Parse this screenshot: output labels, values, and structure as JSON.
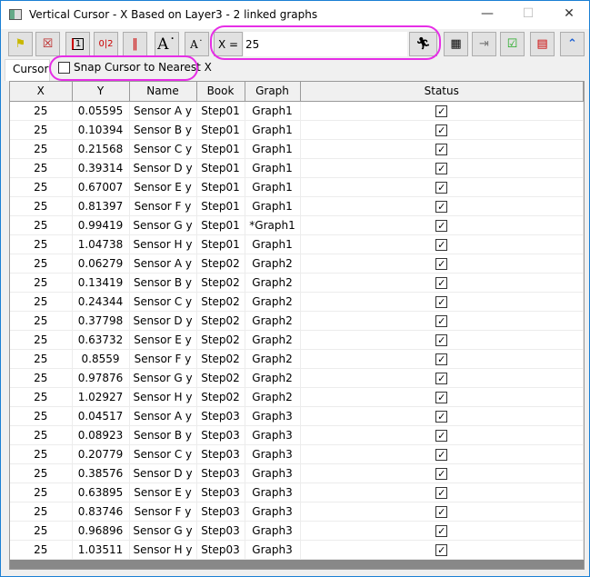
{
  "window": {
    "title": "Vertical Cursor - X Based on Layer3 - 2 linked graphs"
  },
  "toolbar": {
    "x_label": "X =",
    "x_value": "25",
    "buttons": [
      "highlight-icon",
      "delete-label-icon",
      "single-graph-icon",
      "two-graphs-icon",
      "cursor-bars-icon",
      "increase-font-icon",
      "decrease-font-icon"
    ],
    "right_buttons": [
      "worksheet-icon",
      "export-icon",
      "checklist-icon",
      "graph-layers-icon",
      "collapse-icon"
    ]
  },
  "tab": {
    "label": "Cursor"
  },
  "snap": {
    "label": "Snap Cursor to Nearest X",
    "checked": false
  },
  "highlight_color": "#e62ee6",
  "table": {
    "headers": [
      "X",
      "Y",
      "Name",
      "Book",
      "Graph",
      "Status"
    ],
    "rows": [
      [
        "25",
        "0.05595",
        "Sensor A y",
        "Step01",
        "Graph1",
        true
      ],
      [
        "25",
        "0.10394",
        "Sensor B y",
        "Step01",
        "Graph1",
        true
      ],
      [
        "25",
        "0.21568",
        "Sensor C y",
        "Step01",
        "Graph1",
        true
      ],
      [
        "25",
        "0.39314",
        "Sensor D y",
        "Step01",
        "Graph1",
        true
      ],
      [
        "25",
        "0.67007",
        "Sensor E y",
        "Step01",
        "Graph1",
        true
      ],
      [
        "25",
        "0.81397",
        "Sensor F y",
        "Step01",
        "Graph1",
        true
      ],
      [
        "25",
        "0.99419",
        "Sensor G y",
        "Step01",
        "*Graph1",
        true
      ],
      [
        "25",
        "1.04738",
        "Sensor H y",
        "Step01",
        "Graph1",
        true
      ],
      [
        "25",
        "0.06279",
        "Sensor A y",
        "Step02",
        "Graph2",
        true
      ],
      [
        "25",
        "0.13419",
        "Sensor B y",
        "Step02",
        "Graph2",
        true
      ],
      [
        "25",
        "0.24344",
        "Sensor C y",
        "Step02",
        "Graph2",
        true
      ],
      [
        "25",
        "0.37798",
        "Sensor D y",
        "Step02",
        "Graph2",
        true
      ],
      [
        "25",
        "0.63732",
        "Sensor E y",
        "Step02",
        "Graph2",
        true
      ],
      [
        "25",
        "0.8559",
        "Sensor F y",
        "Step02",
        "Graph2",
        true
      ],
      [
        "25",
        "0.97876",
        "Sensor G y",
        "Step02",
        "Graph2",
        true
      ],
      [
        "25",
        "1.02927",
        "Sensor H y",
        "Step02",
        "Graph2",
        true
      ],
      [
        "25",
        "0.04517",
        "Sensor A y",
        "Step03",
        "Graph3",
        true
      ],
      [
        "25",
        "0.08923",
        "Sensor B y",
        "Step03",
        "Graph3",
        true
      ],
      [
        "25",
        "0.20779",
        "Sensor C y",
        "Step03",
        "Graph3",
        true
      ],
      [
        "25",
        "0.38576",
        "Sensor D y",
        "Step03",
        "Graph3",
        true
      ],
      [
        "25",
        "0.63895",
        "Sensor E y",
        "Step03",
        "Graph3",
        true
      ],
      [
        "25",
        "0.83746",
        "Sensor F y",
        "Step03",
        "Graph3",
        true
      ],
      [
        "25",
        "0.96896",
        "Sensor G y",
        "Step03",
        "Graph3",
        true
      ],
      [
        "25",
        "1.03511",
        "Sensor H y",
        "Step03",
        "Graph3",
        true
      ]
    ]
  }
}
